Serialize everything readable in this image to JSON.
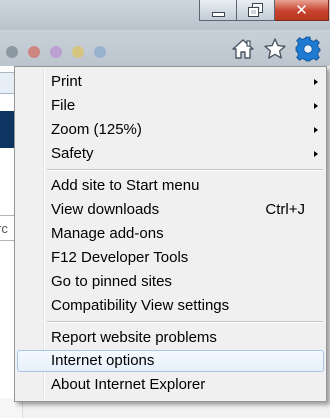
{
  "window": {
    "minimize_icon": "minimize-icon",
    "maximize_icon": "restore-icon",
    "close_glyph": "✕"
  },
  "toolbar": {
    "home_icon": "home-icon",
    "favorites_icon": "star-icon",
    "tools_icon": "gear-icon"
  },
  "page": {
    "search_fragment": "rc"
  },
  "menu": {
    "items": [
      {
        "label": "Print",
        "submenu": true
      },
      {
        "label": "File",
        "submenu": true
      },
      {
        "label": "Zoom (125%)",
        "submenu": true
      },
      {
        "label": "Safety",
        "submenu": true
      },
      {
        "label": "Add site to Start menu"
      },
      {
        "label": "View downloads",
        "shortcut": "Ctrl+J"
      },
      {
        "label": "Manage add-ons"
      },
      {
        "label": "F12 Developer Tools"
      },
      {
        "label": "Go to pinned sites"
      },
      {
        "label": "Compatibility View settings"
      },
      {
        "label": "Report website problems"
      },
      {
        "label": "Internet options",
        "highlighted": true
      },
      {
        "label": "About Internet Explorer"
      }
    ]
  },
  "colors": {
    "highlight_border": "#a7c6ea",
    "close_button": "#c7432e",
    "gear_blue": "#1f7ad1",
    "page_nav": "#0e3462"
  }
}
